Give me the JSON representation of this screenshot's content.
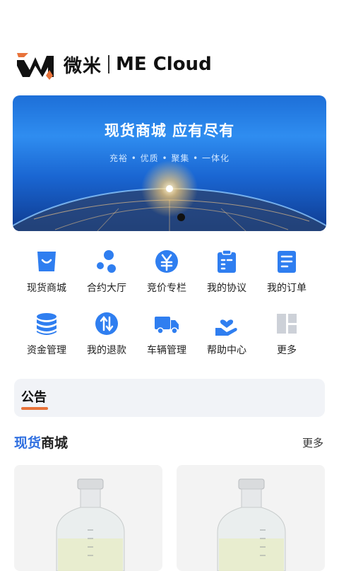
{
  "header": {
    "logo_cn": "微米",
    "logo_en": "ME Cloud"
  },
  "banner": {
    "title": "现货商城  应有尽有",
    "subtitle": "充裕 • 优质 • 聚集 • 一体化"
  },
  "menu": [
    {
      "label": "现货商城",
      "icon": "shop-bag-icon"
    },
    {
      "label": "合约大厅",
      "icon": "dots-icon"
    },
    {
      "label": "竞价专栏",
      "icon": "yen-icon"
    },
    {
      "label": "我的协议",
      "icon": "clipboard-icon"
    },
    {
      "label": "我的订单",
      "icon": "order-doc-icon"
    },
    {
      "label": "资金管理",
      "icon": "coins-stack-icon"
    },
    {
      "label": "我的退款",
      "icon": "refund-arrows-icon"
    },
    {
      "label": "车辆管理",
      "icon": "truck-icon"
    },
    {
      "label": "帮助中心",
      "icon": "hand-heart-icon"
    },
    {
      "label": "更多",
      "icon": "more-grid-icon"
    }
  ],
  "notice": {
    "title": "公告"
  },
  "section": {
    "title_highlight": "现货",
    "title_rest": "商城",
    "more": "更多"
  },
  "colors": {
    "accent": "#2f6fe0",
    "notice_underline": "#e8733a",
    "logo_orange": "#e8733a"
  }
}
